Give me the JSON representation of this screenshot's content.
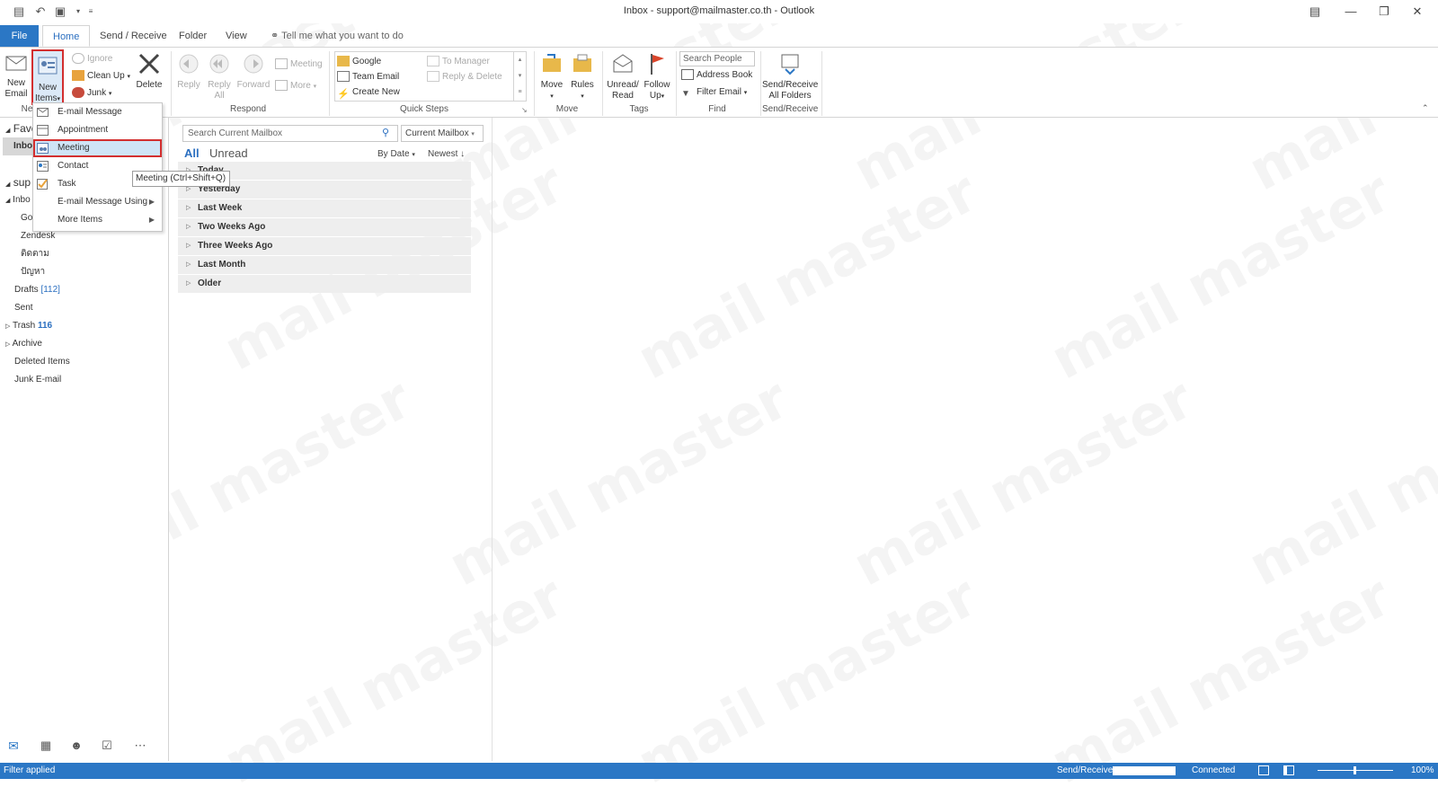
{
  "window": {
    "title": "Inbox - support@mailmaster.co.th  -  Outlook"
  },
  "tabs": [
    {
      "label": "File"
    },
    {
      "label": "Home"
    },
    {
      "label": "Send / Receive"
    },
    {
      "label": "Folder"
    },
    {
      "label": "View"
    }
  ],
  "tell_me": "Tell me what you want to do",
  "ribbon": {
    "new_email": "New\nEmail",
    "new_email_l1": "New",
    "new_email_l2": "Email",
    "new_items_l1": "New",
    "new_items_l2": "Items",
    "ignore": "Ignore",
    "clean_up": "Clean Up",
    "junk": "Junk",
    "delete": "Delete",
    "reply": "Reply",
    "reply_all_l1": "Reply",
    "reply_all_l2": "All",
    "forward": "Forward",
    "meeting": "Meeting",
    "more": "More",
    "respond_label": "Respond",
    "qs_google": "Google",
    "qs_team_email": "Team Email",
    "qs_create_new": "Create New",
    "qs_to_manager": "To Manager",
    "qs_reply_delete": "Reply & Delete",
    "quick_steps_label": "Quick Steps",
    "move": "Move",
    "rules": "Rules",
    "move_label": "Move",
    "unread_l1": "Unread/",
    "unread_l2": "Read",
    "follow_l1": "Follow",
    "follow_l2": "Up",
    "tags_label": "Tags",
    "search_people": "Search People",
    "address_book": "Address Book",
    "filter_email": "Filter Email",
    "find_label": "Find",
    "send_receive_l1": "Send/Receive",
    "send_receive_l2": "All Folders",
    "send_receive_label": "Send/Receive",
    "new_label": "Ne"
  },
  "leftnav": {
    "favorites": "Favo",
    "inbox_fav": "Inbo",
    "account": "sup",
    "inbox": "Inbo",
    "sub1": "Go",
    "items": [
      {
        "label": "Zendesk",
        "count": ""
      },
      {
        "label": "ติดตาม",
        "count": ""
      },
      {
        "label": "ปัญหา",
        "count": ""
      },
      {
        "label": "Drafts",
        "count": "[112]"
      },
      {
        "label": "Sent",
        "count": ""
      },
      {
        "label": "Trash",
        "count": "116"
      },
      {
        "label": "Archive",
        "count": ""
      },
      {
        "label": "Deleted Items",
        "count": ""
      },
      {
        "label": "Junk E-mail",
        "count": ""
      }
    ]
  },
  "dropdown": {
    "items": [
      {
        "label": "E-mail Message"
      },
      {
        "label": "Appointment"
      },
      {
        "label": "Meeting"
      },
      {
        "label": "Contact"
      },
      {
        "label": "Task"
      },
      {
        "label": "E-mail Message Using"
      },
      {
        "label": "More Items"
      }
    ],
    "tooltip": "Meeting (Ctrl+Shift+Q)"
  },
  "messagelist": {
    "search_placeholder": "Search Current Mailbox",
    "scope": "Current Mailbox",
    "filter_all": "All",
    "filter_unread": "Unread",
    "sort_by": "By Date",
    "order": "Newest",
    "groups": [
      {
        "label": "Today"
      },
      {
        "label": "Yesterday"
      },
      {
        "label": "Last Week"
      },
      {
        "label": "Two Weeks Ago"
      },
      {
        "label": "Three Weeks Ago"
      },
      {
        "label": "Last Month"
      },
      {
        "label": "Older"
      }
    ]
  },
  "statusbar": {
    "left": "Filter applied",
    "send_receive": "Send/Receive",
    "connected": "Connected",
    "zoom": "100%"
  },
  "watermark": "mail master",
  "colors": {
    "accent": "#2b77c5",
    "highlight": "#cfe4f6",
    "callout": "#d32f2f"
  }
}
